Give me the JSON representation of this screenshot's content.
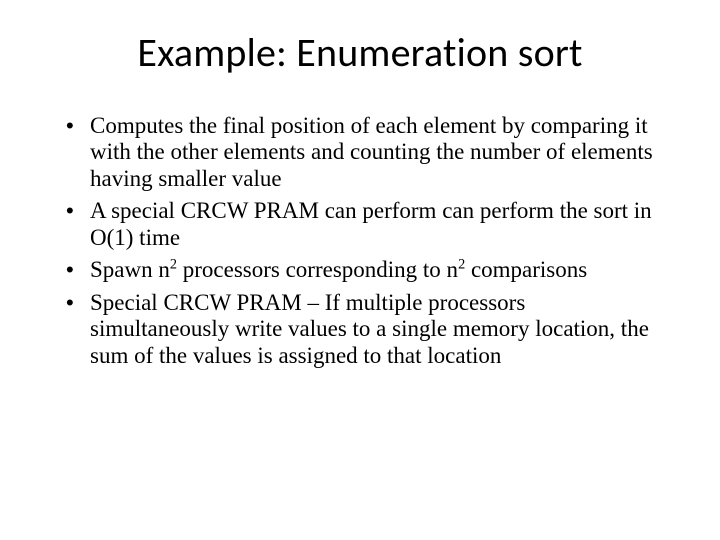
{
  "slide": {
    "title": "Example: Enumeration sort",
    "bullets": [
      {
        "html": "Computes the final position of each element by comparing it with the other elements and counting the number of elements having smaller value"
      },
      {
        "html": "A special CRCW PRAM can perform can perform the sort in O(1) time"
      },
      {
        "html": "Spawn n<sup>2</sup> processors corresponding to n<sup>2</sup> comparisons"
      },
      {
        "html": "Special CRCW PRAM – If multiple processors simultaneously write values to a single memory location, the sum of the values is assigned to that location"
      }
    ]
  }
}
